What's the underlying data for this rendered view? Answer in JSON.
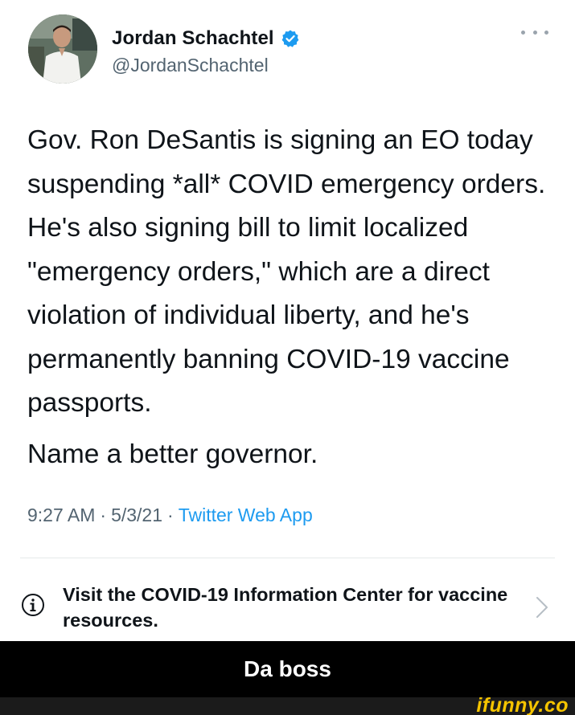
{
  "tweet": {
    "author": {
      "display_name": "Jordan Schachtel",
      "handle": "@JordanSchachtel",
      "verified": true,
      "avatar_icon": "profile-photo"
    },
    "body": {
      "paragraph1": "Gov. Ron DeSantis is signing an EO today suspending *all* COVID emergency orders. He's also signing bill to limit localized \"emergency orders,\" which are a direct violation of individual liberty, and he's permanently banning COVID-19 vaccine passports.",
      "paragraph2": "Name a better governor."
    },
    "meta": {
      "time": "9:27 AM",
      "separator": "·",
      "date": "5/3/21",
      "source": "Twitter Web App"
    },
    "info_notice": {
      "text": "Visit the COVID-19 Information Center for vaccine resources.",
      "icon": "info-icon"
    },
    "more_icon": "more-horizontal-icon"
  },
  "caption": "Da boss",
  "watermark": "ifunny.co",
  "colors": {
    "accent": "#1d9bf0",
    "secondary_text": "#536471",
    "caption_bg": "#000000",
    "watermark": "#f5c400"
  }
}
